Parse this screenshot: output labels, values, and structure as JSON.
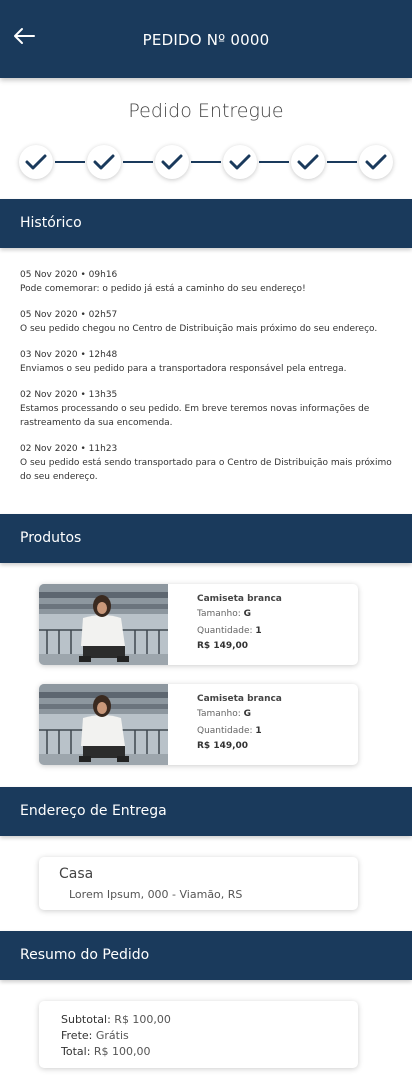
{
  "header": {
    "title": "PEDIDO Nº 0000",
    "back_icon": "arrow-left-icon"
  },
  "status": {
    "title": "Pedido Entregue",
    "steps_completed": 6,
    "steps_total": 6,
    "step_icon": "check-icon"
  },
  "history": {
    "title": "Histórico",
    "items": [
      {
        "date": "05 Nov 2020 • 09h16",
        "text": "Pode comemorar: o pedido já está a caminho do seu endereço!"
      },
      {
        "date": "05 Nov 2020 • 02h57",
        "text": "O seu pedido chegou no Centro de Distribuição mais próximo do seu endereço."
      },
      {
        "date": "03 Nov 2020 • 12h48",
        "text": "Enviamos o seu pedido para a transportadora responsável pela entrega."
      },
      {
        "date": "02 Nov 2020 • 13h35",
        "text": "Estamos processando o seu pedido. Em breve teremos novas informações de rastreamento da sua encomenda."
      },
      {
        "date": "02 Nov 2020 • 11h23",
        "text": "O seu pedido está sendo transportado para o Centro de Distribuição mais próximo do seu endereço."
      }
    ]
  },
  "products": {
    "title": "Produtos",
    "items": [
      {
        "name": "Camiseta branca",
        "size_label": "Tamanho:",
        "size": "G",
        "qty_label": "Quantidade:",
        "qty": "1",
        "price": "R$ 149,00"
      },
      {
        "name": "Camiseta branca",
        "size_label": "Tamanho:",
        "size": "G",
        "qty_label": "Quantidade:",
        "qty": "1",
        "price": "R$ 149,00"
      }
    ]
  },
  "address": {
    "title": "Endereço de Entrega",
    "name": "Casa",
    "line": "Lorem Ipsum, 000 - Viamão, RS"
  },
  "summary": {
    "title": "Resumo do Pedido",
    "subtotal_label": "Subtotal:",
    "subtotal": "R$ 100,00",
    "shipping_label": "Frete:",
    "shipping": "Grátis",
    "total_label": "Total:",
    "total": "R$ 100,00"
  },
  "colors": {
    "primary": "#1a3a5c",
    "background": "#ffffff"
  }
}
